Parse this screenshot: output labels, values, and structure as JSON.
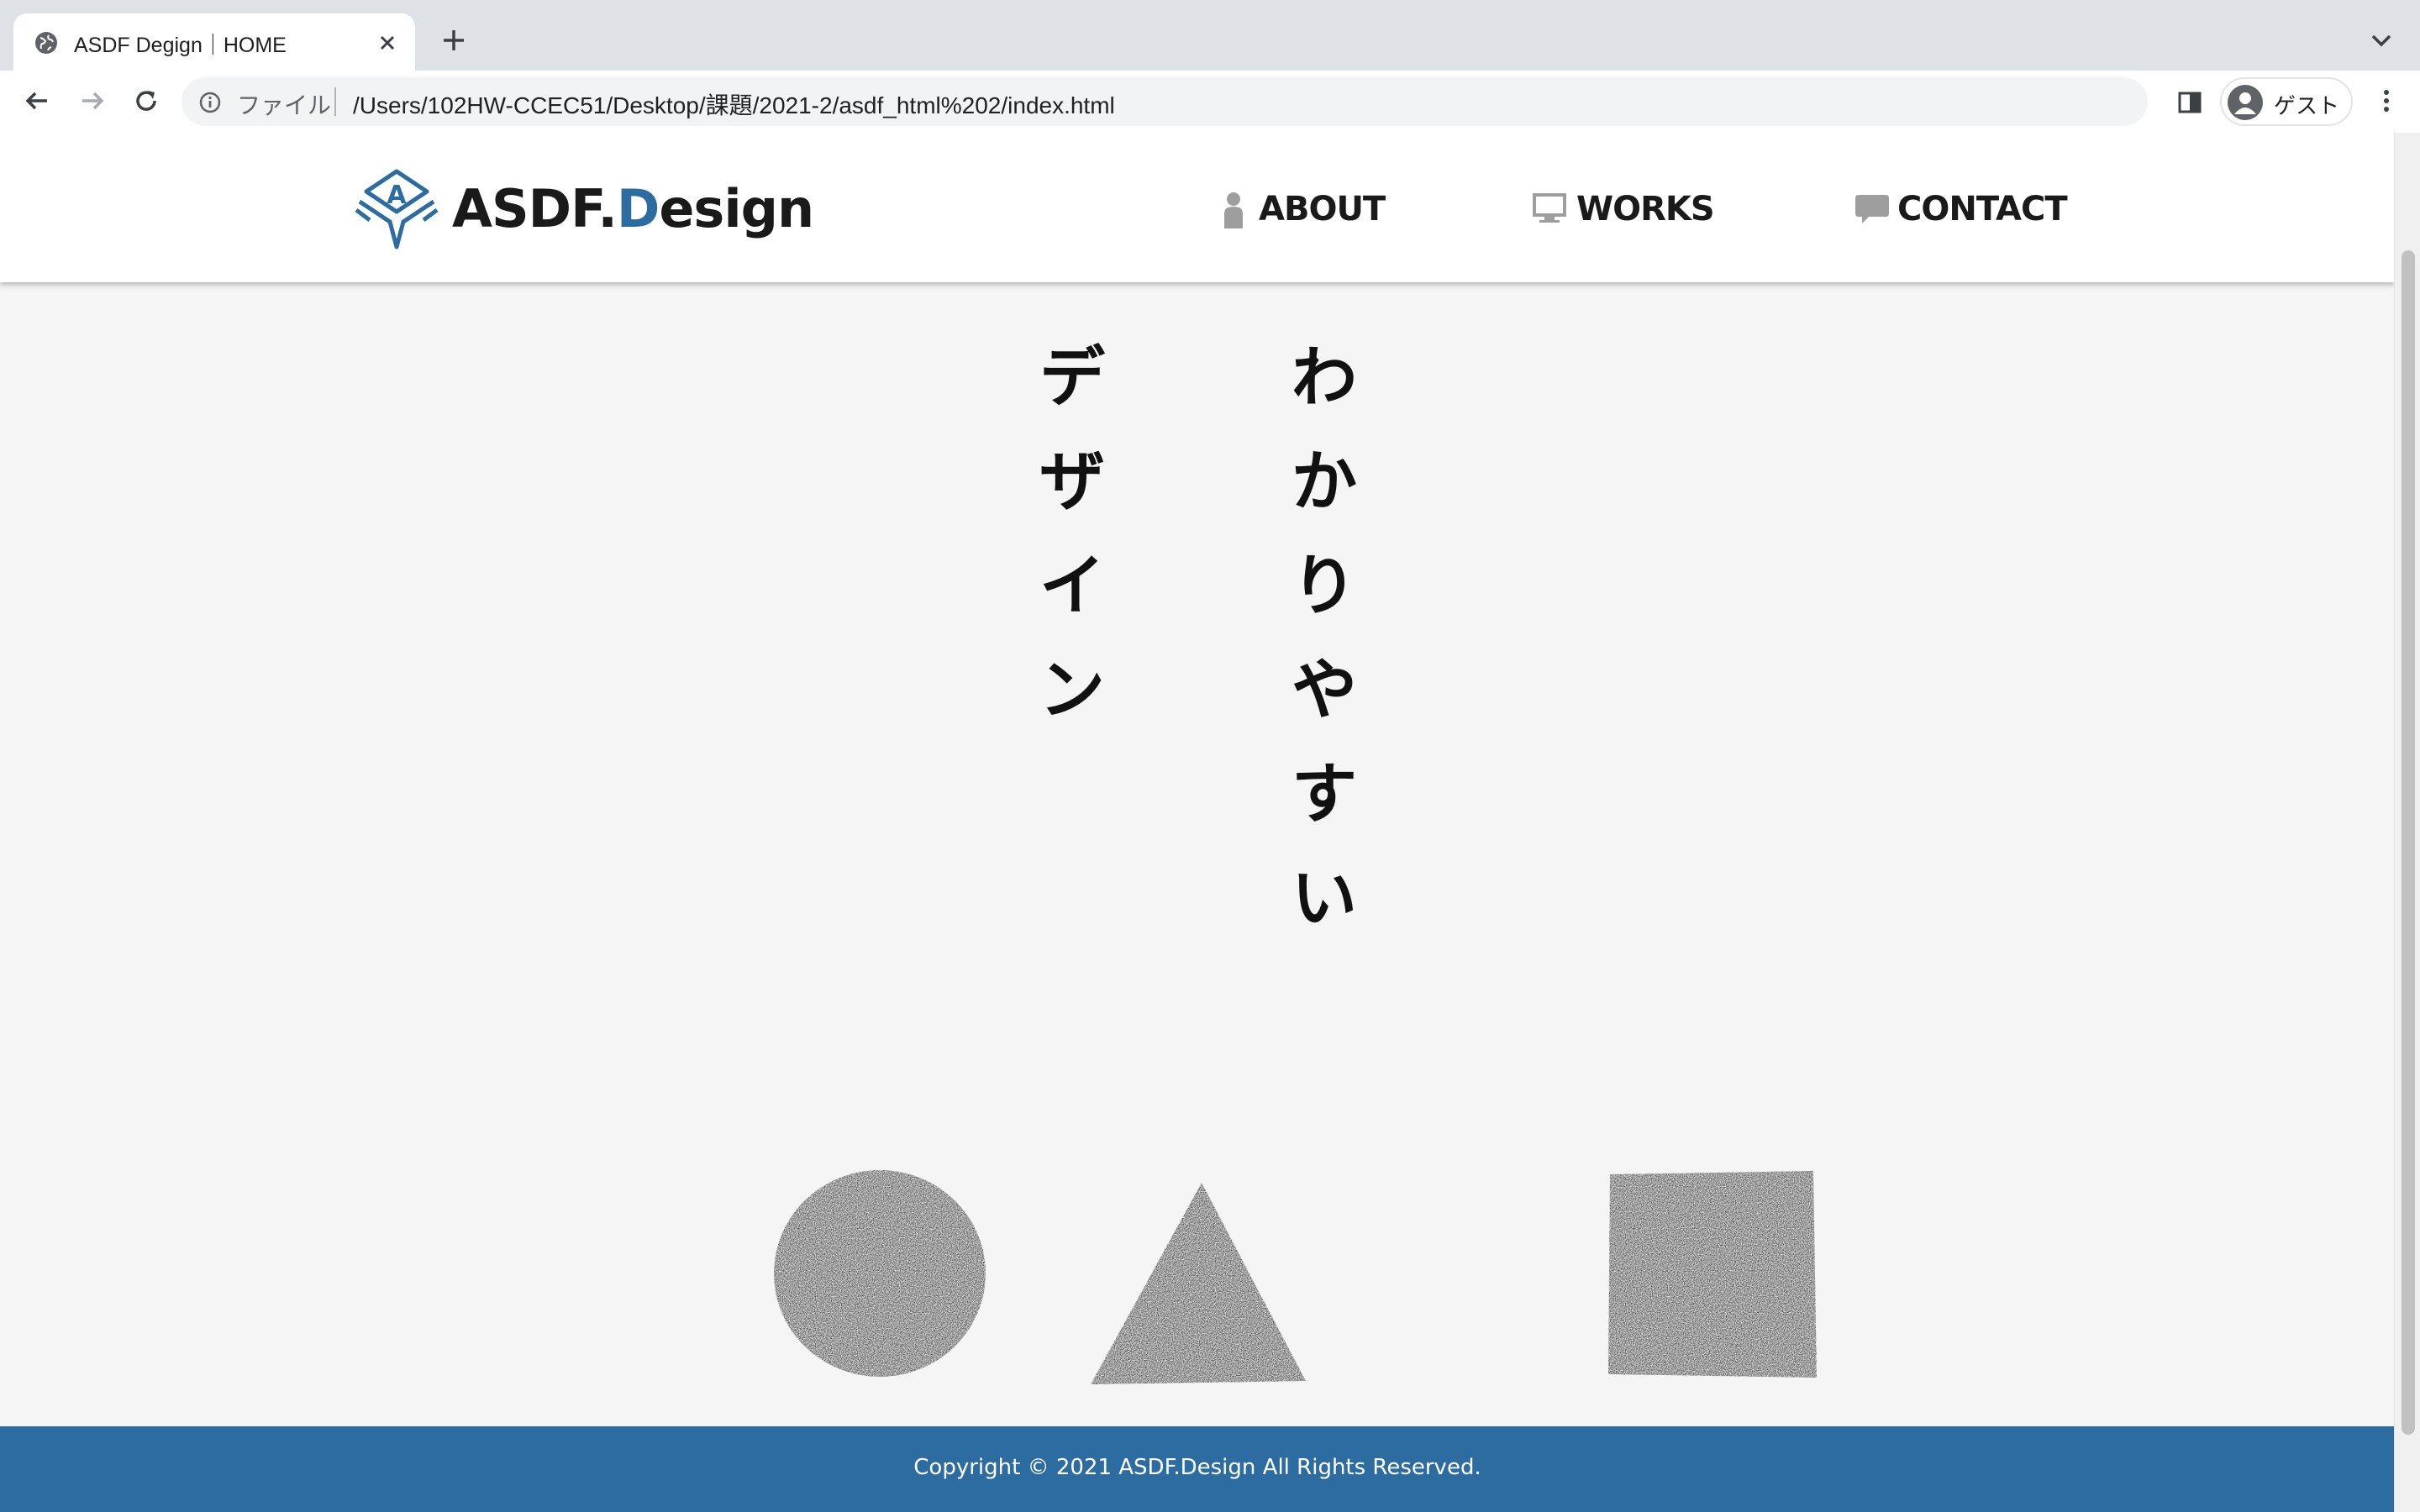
{
  "browser": {
    "tab_title": "ASDF Degign｜HOME",
    "scheme_label": "ファイル",
    "url": "/Users/102HW-CCEC51/Desktop/課題/2021-2/asdf_html%202/index.html",
    "profile_label": "ゲスト"
  },
  "header": {
    "logo_main": "ASDF.",
    "logo_accent": "D",
    "logo_rest": "esign",
    "nav": {
      "about": "ABOUT",
      "works": "WORKS",
      "contact": "CONTACT"
    }
  },
  "hero": {
    "col_right": [
      "わ",
      "か",
      "り",
      "や",
      "す",
      "い"
    ],
    "col_left": [
      "デ",
      "ザ",
      "イ",
      "ン"
    ]
  },
  "footer": {
    "copyright": "Copyright © 2021 ASDF.Design All Rights Reserved."
  },
  "colors": {
    "brand_blue": "#2c6ca1",
    "page_bg": "#f5f5f5",
    "nav_icon_gray": "#9e9e9e"
  },
  "icons": {
    "tab": "globe-icon",
    "nav_about": "person-icon",
    "nav_works": "monitor-icon",
    "nav_contact": "speech-bubble-icon"
  }
}
